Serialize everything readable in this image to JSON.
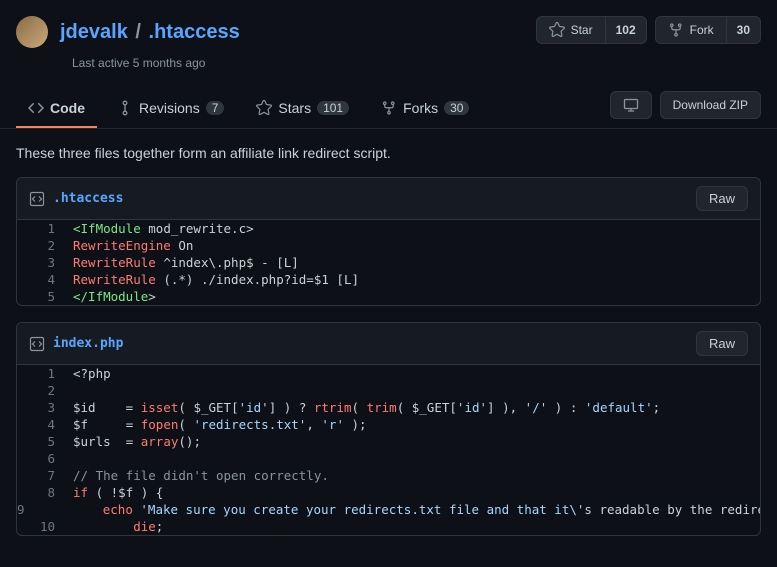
{
  "header": {
    "owner": "jdevalk",
    "sep": "/",
    "repo": ".htaccess",
    "subtitle": "Last active 5 months ago",
    "star_label": "Star",
    "star_count": "102",
    "fork_label": "Fork",
    "fork_count": "30"
  },
  "tabs": {
    "code": "Code",
    "revisions": "Revisions",
    "revisions_count": "7",
    "stars": "Stars",
    "stars_count": "101",
    "forks": "Forks",
    "forks_count": "30",
    "download": "Download ZIP"
  },
  "description": "These three files together form an affiliate link redirect script.",
  "files": [
    {
      "name": ".htaccess",
      "raw": "Raw"
    },
    {
      "name": "index.php",
      "raw": "Raw"
    }
  ],
  "chart_data": {
    "type": "table",
    "files": [
      {
        "name": ".htaccess",
        "lines": [
          "<IfModule mod_rewrite.c>",
          "RewriteEngine On",
          "RewriteRule ^index\\.php$ - [L]",
          "RewriteRule (.*) ./index.php?id=$1 [L]",
          "</IfModule>"
        ]
      },
      {
        "name": "index.php",
        "lines": [
          "<?php",
          "",
          "$id    = isset( $_GET['id'] ) ? rtrim( trim( $_GET['id'] ), '/' ) : 'default';",
          "$f     = fopen( 'redirects.txt', 'r' );",
          "$urls  = array();",
          "",
          "// The file didn't open correctly.",
          "if ( !$f ) {",
          "        echo 'Make sure you create your redirects.txt file and that it\\'s readable by the redirect script.",
          "        die;"
        ]
      }
    ]
  }
}
